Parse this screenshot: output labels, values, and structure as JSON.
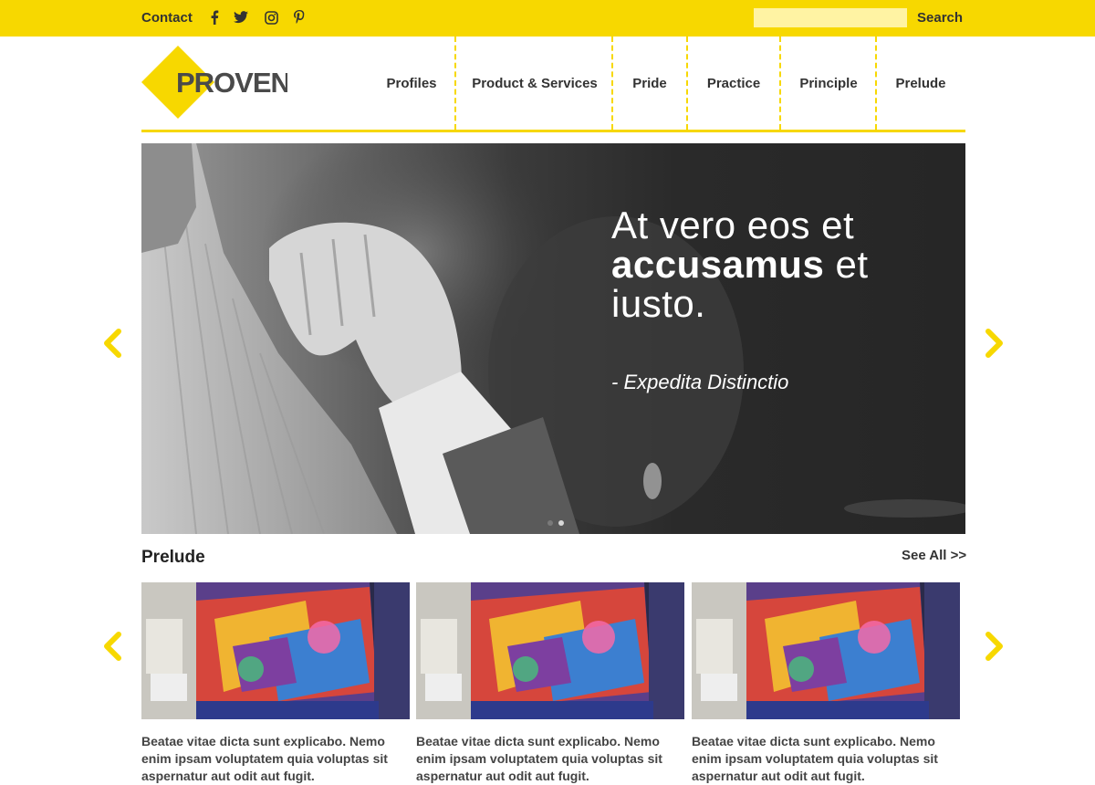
{
  "topbar": {
    "contact_label": "Contact",
    "social_icons": [
      "facebook-icon",
      "twitter-icon",
      "instagram-icon",
      "pinterest-icon"
    ],
    "search_value": "",
    "search_button_label": "Search"
  },
  "header": {
    "logo_text": "PROVEN",
    "nav": [
      {
        "label": "Profiles"
      },
      {
        "label": "Product & Services"
      },
      {
        "label": "Pride"
      },
      {
        "label": "Practice"
      },
      {
        "label": "Principle"
      },
      {
        "label": "Prelude"
      }
    ]
  },
  "hero": {
    "quote_line1": "At vero eos et",
    "quote_bold": "accusamus",
    "quote_line2_rest": " et",
    "quote_line3": "iusto.",
    "author": "- Expedita Distinctio",
    "slides_total": 2,
    "active_slide": 2
  },
  "prelude": {
    "title": "Prelude",
    "see_all_label": "See All >>",
    "cards": [
      {
        "text": "Beatae vitae dicta sunt explicabo. Nemo enim ipsam voluptatem quia voluptas sit aspernatur aut odit aut fugit."
      },
      {
        "text": "Beatae vitae dicta sunt explicabo. Nemo enim ipsam voluptatem quia voluptas sit aspernatur aut odit aut fugit."
      },
      {
        "text": "Beatae vitae dicta sunt explicabo. Nemo enim ipsam voluptatem quia voluptas sit aspernatur aut odit aut fugit."
      }
    ]
  },
  "colors": {
    "accent": "#f7d800",
    "search_field": "#fff3a3",
    "text": "#333333"
  }
}
